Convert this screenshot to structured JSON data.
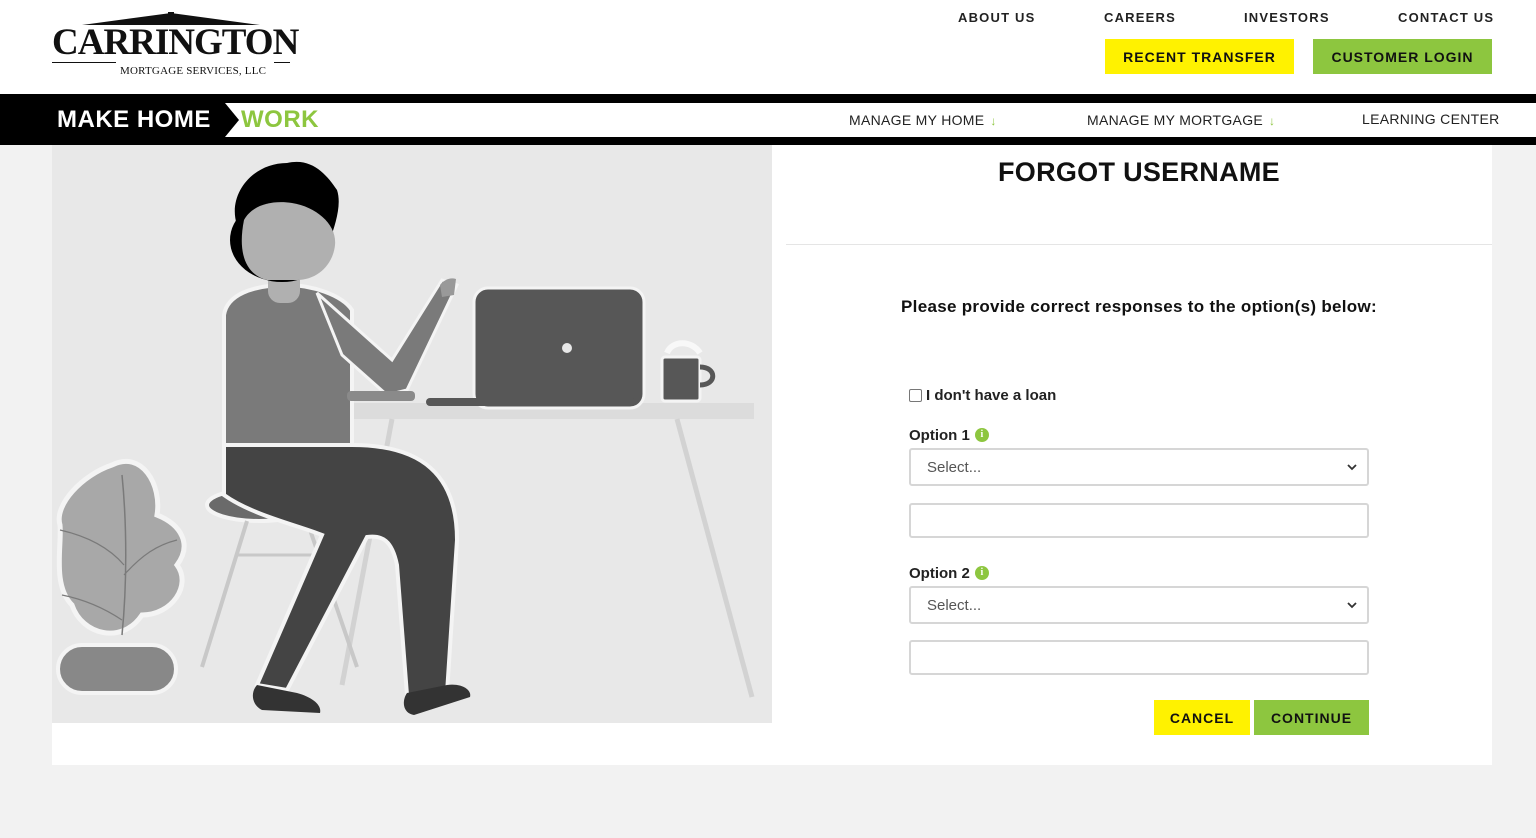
{
  "header": {
    "logo": {
      "name": "CARRINGTON",
      "subtitle": "MORTGAGE SERVICES, LLC"
    },
    "top_nav": [
      "ABOUT US",
      "CAREERS",
      "INVESTORS",
      "CONTACT US"
    ],
    "recent_transfer_label": "RECENT TRANSFER",
    "customer_login_label": "CUSTOMER LOGIN"
  },
  "banner": {
    "tag_make": "MAKE HOME",
    "tag_work": "WORK",
    "nav": [
      {
        "label": "MANAGE MY HOME",
        "icon": "arrow-down-icon"
      },
      {
        "label": "MANAGE MY MORTGAGE",
        "icon": "arrow-down-icon"
      },
      {
        "label": "LEARNING CENTER"
      }
    ]
  },
  "form": {
    "title": "FORGOT USERNAME",
    "instructions": "Please provide correct responses to the option(s) below:",
    "no_loan_label": "I don't have a loan",
    "no_loan_checked": false,
    "option1": {
      "label": "Option 1",
      "select_value": "Select...",
      "input_value": ""
    },
    "option2": {
      "label": "Option 2",
      "select_value": "Select...",
      "input_value": ""
    },
    "cancel_label": "CANCEL",
    "continue_label": "CONTINUE"
  },
  "colors": {
    "accent_yellow": "#fff200",
    "accent_green": "#8dc63f",
    "banner_black": "#000000",
    "page_bg": "#f2f2f2"
  }
}
